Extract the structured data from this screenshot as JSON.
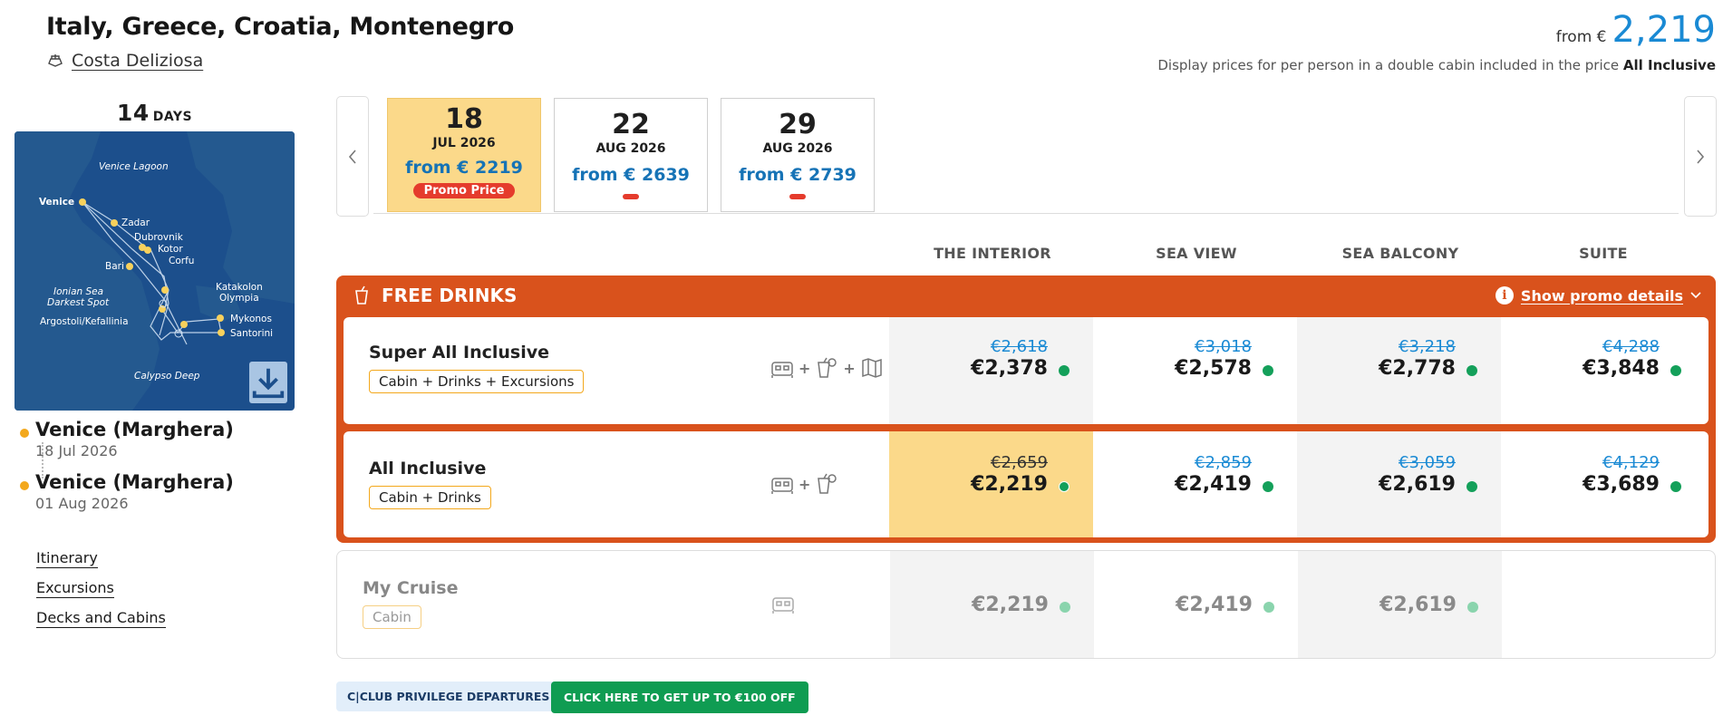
{
  "header": {
    "title": "Italy, Greece, Croatia, Montenegro",
    "ship_name": "Costa Deliziosa",
    "price_from_label": "from €",
    "price_from_value": "2,219",
    "price_note": "Display prices for per person in a double cabin included in the price",
    "price_note_bold": "All Inclusive"
  },
  "itinerary": {
    "days_number": "14",
    "days_label": "DAYS",
    "map_labels": [
      "Venice Lagoon",
      "Venice",
      "Zadar",
      "Dubrovnik",
      "Kotor",
      "Corfu",
      "Bari",
      "Ionian Sea",
      "Darkest Spot",
      "Katakolon",
      "Olympia",
      "Argostoli/Kefallinia",
      "Mykonos",
      "Santorini",
      "Calypso Deep"
    ],
    "stops": [
      {
        "port": "Venice (Marghera)",
        "date": "18 Jul 2026"
      },
      {
        "port": "Venice (Marghera)",
        "date": "01 Aug 2026"
      }
    ],
    "links": [
      "Itinerary",
      "Excursions",
      "Decks and Cabins"
    ]
  },
  "dates": [
    {
      "day": "18",
      "month": "JUL 2026",
      "price": "from € 2219",
      "badge": "Promo Price",
      "active": true
    },
    {
      "day": "22",
      "month": "AUG 2026",
      "price": "from € 2639",
      "badge": "",
      "active": false
    },
    {
      "day": "29",
      "month": "AUG 2026",
      "price": "from € 2739",
      "badge": "",
      "active": false
    }
  ],
  "columns": [
    "THE INTERIOR",
    "SEA VIEW",
    "SEA BALCONY",
    "SUITE"
  ],
  "promo": {
    "title": "FREE DRINKS",
    "details_label": "Show promo details"
  },
  "packages": [
    {
      "name": "Super All Inclusive",
      "tag": "Cabin + Drinks + Excursions",
      "old": [
        "€2,618",
        "€3,018",
        "€3,218",
        "€4,288"
      ],
      "now": [
        "€2,378",
        "€2,578",
        "€2,778",
        "€3,848"
      ]
    },
    {
      "name": "All Inclusive",
      "tag": "Cabin + Drinks",
      "old": [
        "€2,659",
        "€2,859",
        "€3,059",
        "€4,129"
      ],
      "now": [
        "€2,219",
        "€2,419",
        "€2,619",
        "€3,689"
      ]
    },
    {
      "name": "My Cruise",
      "tag": "Cabin",
      "now": [
        "€2,219",
        "€2,419",
        "€2,619"
      ]
    }
  ],
  "buttons": {
    "club": "C|CLUB PRIVILEGE DEPARTURES",
    "discount": "CLICK HERE TO GET UP TO €100 OFF"
  },
  "colors": {
    "promo_orange": "#d9521c",
    "selected_yellow": "#fbd98a",
    "price_blue": "#1a8ad4",
    "availability_green": "#14a05a",
    "promo_badge_red": "#e53b2c"
  }
}
